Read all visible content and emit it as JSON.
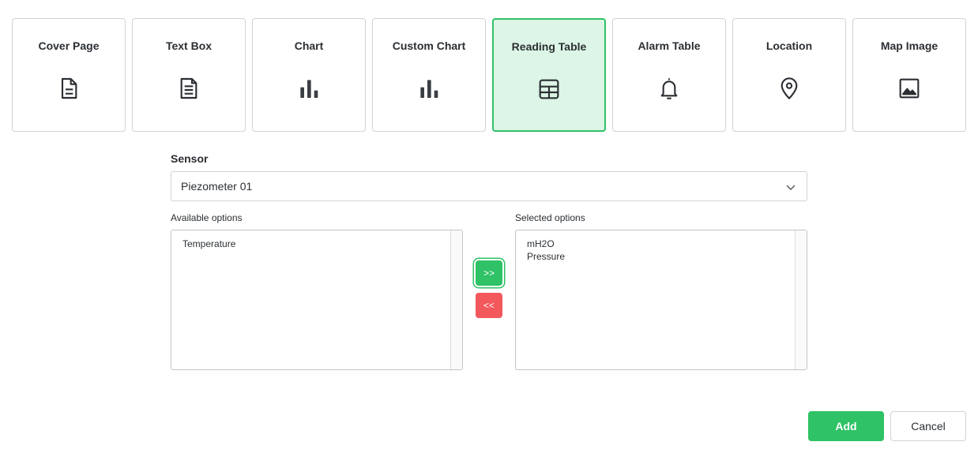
{
  "cards": [
    {
      "label": "Cover Page",
      "icon": "document-icon"
    },
    {
      "label": "Text Box",
      "icon": "text-document-icon"
    },
    {
      "label": "Chart",
      "icon": "bar-chart-icon"
    },
    {
      "label": "Custom Chart",
      "icon": "bar-chart-icon"
    },
    {
      "label": "Reading Table",
      "icon": "table-icon",
      "selected": true
    },
    {
      "label": "Alarm Table",
      "icon": "bell-icon"
    },
    {
      "label": "Location",
      "icon": "map-pin-icon"
    },
    {
      "label": "Map Image",
      "icon": "image-icon"
    }
  ],
  "sensor": {
    "label": "Sensor",
    "value": "Piezometer 01"
  },
  "available": {
    "label": "Available options",
    "items": [
      "Temperature"
    ]
  },
  "selected": {
    "label": "Selected options",
    "items": [
      "mH2O",
      "Pressure"
    ]
  },
  "transfer": {
    "add_label": ">>",
    "remove_label": "<<"
  },
  "actions": {
    "add_label": "Add",
    "cancel_label": "Cancel"
  },
  "colors": {
    "accent": "#2fc266",
    "accent_light": "#dcf5e6",
    "danger": "#f2585c",
    "text": "#2b2f33",
    "border": "#cfd3d7"
  }
}
